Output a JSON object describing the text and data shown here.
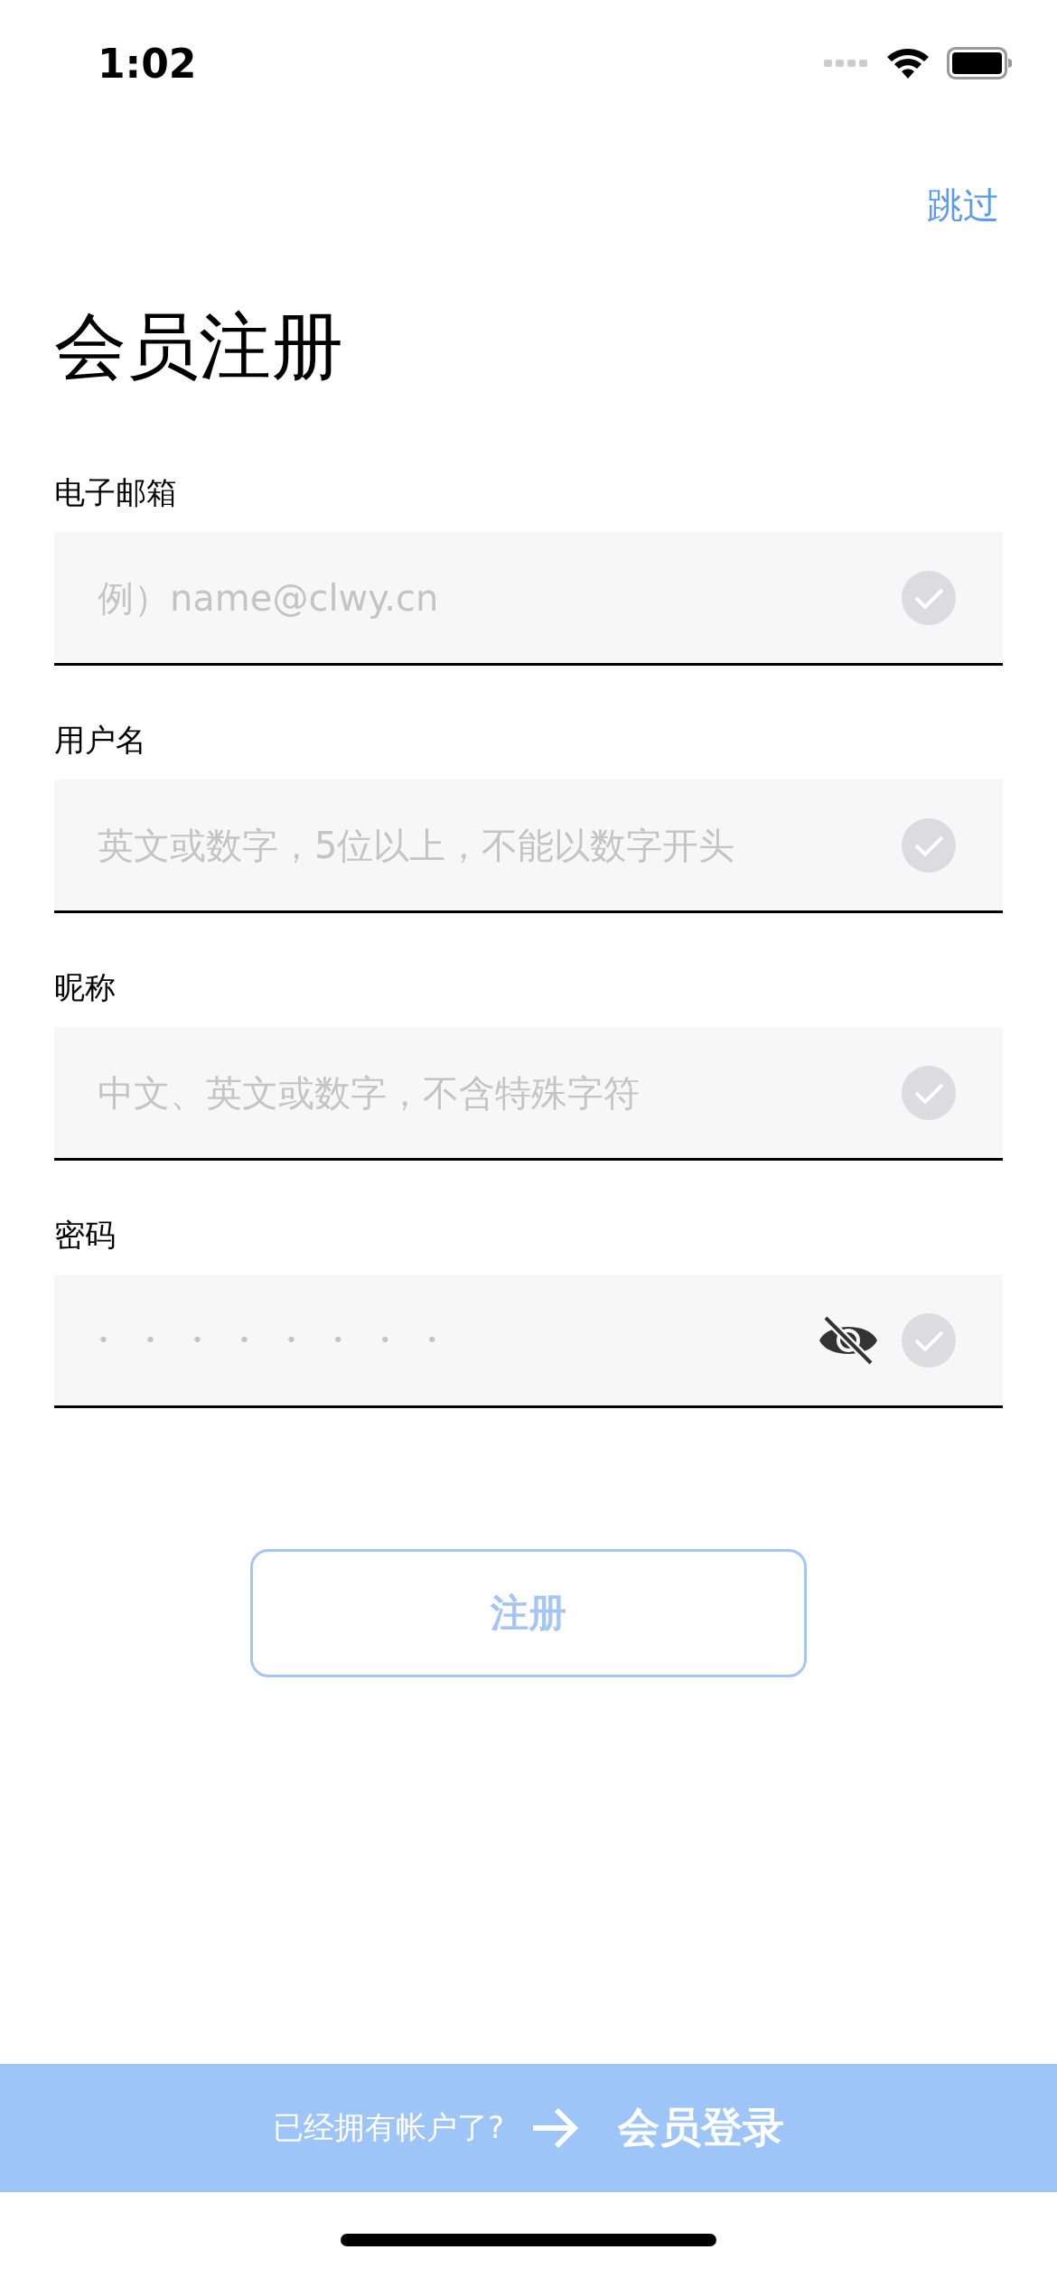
{
  "status_bar": {
    "time": "1:02"
  },
  "skip": "跳过",
  "title": "会员注册",
  "fields": [
    {
      "label": "电子邮箱",
      "placeholder": "例）name@clwy.cn",
      "kind": "text",
      "valid": false
    },
    {
      "label": "用户名",
      "placeholder": "英文或数字，5位以上，不能以数字开头",
      "kind": "text",
      "valid": false
    },
    {
      "label": "昵称",
      "placeholder": "中文、英文或数字，不含特殊字符",
      "kind": "text",
      "valid": false
    },
    {
      "label": "密码",
      "placeholder": "• • • • • • • •",
      "kind": "password",
      "password_visible": false,
      "valid": false
    }
  ],
  "register_button": {
    "label": "注册",
    "disabled": true
  },
  "footer": {
    "prompt": "已经拥有帐户了?",
    "link": "会员登录"
  }
}
